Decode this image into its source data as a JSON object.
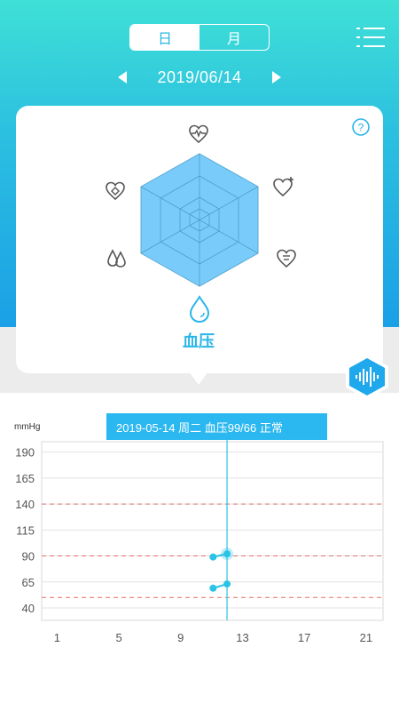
{
  "header": {
    "tabs": [
      {
        "label": "日",
        "active": true
      },
      {
        "label": "月",
        "active": false
      }
    ],
    "date": "2019/06/14"
  },
  "radar_card": {
    "selected_metric": "血压",
    "dimensions": [
      "heart-rate",
      "heart-plus",
      "emotion",
      "blood-pressure",
      "blood-drops",
      "diamond-heart"
    ]
  },
  "chart_data": {
    "type": "line",
    "unit": "mmHg",
    "tooltip": "2019-05-14 周二   血压99/66 正常",
    "y_ticks": [
      190,
      165,
      140,
      115,
      90,
      65,
      40
    ],
    "x_ticks": [
      1,
      5,
      9,
      13,
      17,
      21
    ],
    "ylim": [
      28,
      200
    ],
    "xlim": [
      0,
      22.1
    ],
    "reference_lines": [
      140,
      90,
      50
    ],
    "selected_x": 12,
    "series": [
      {
        "values": [
          [
            11.1,
            89
          ],
          [
            12,
            92
          ]
        ]
      },
      {
        "values": [
          [
            11.1,
            59
          ],
          [
            12,
            63
          ]
        ]
      }
    ],
    "colors": {
      "accent": "#29c3e6",
      "reference": "#e0706a",
      "grid": "#d8d8d8"
    }
  }
}
